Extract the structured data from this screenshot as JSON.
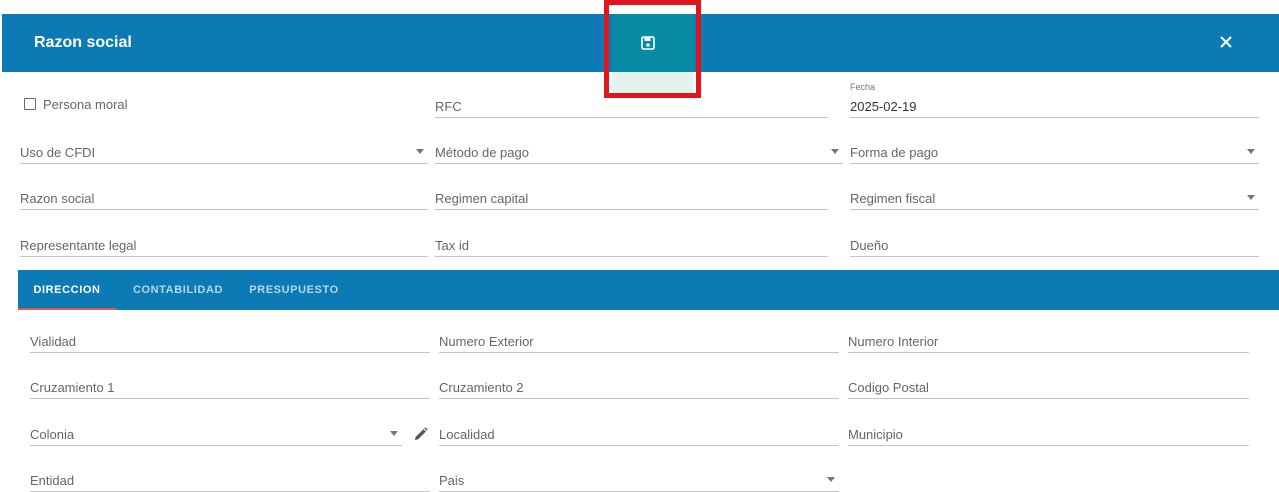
{
  "header": {
    "title": "Razon social",
    "save_icon": "floppy-disk-icon",
    "close_icon": "close-icon",
    "color": "#0c7ab5"
  },
  "form": {
    "persona_moral_label": "Persona moral",
    "rfc_placeholder": "RFC",
    "fecha_label": "Fecha",
    "fecha_value": "2025-02-19",
    "uso_cfdi_placeholder": "Uso de CFDI",
    "metodo_pago_placeholder": "Método de pago",
    "forma_pago_placeholder": "Forma de pago",
    "razon_social_placeholder": "Razon social",
    "regimen_capital_placeholder": "Regimen capital",
    "regimen_fiscal_placeholder": "Regimen fiscal",
    "representante_legal_placeholder": "Representante legal",
    "tax_id_placeholder": "Tax id",
    "dueno_placeholder": "Dueño"
  },
  "tabs": [
    {
      "label": "DIRECCION",
      "active": true
    },
    {
      "label": "CONTABILIDAD",
      "active": false
    },
    {
      "label": "PRESUPUESTO",
      "active": false
    }
  ],
  "direccion": {
    "vialidad_placeholder": "Vialidad",
    "numero_exterior_placeholder": "Numero Exterior",
    "numero_interior_placeholder": "Numero Interior",
    "cruzamiento1_placeholder": "Cruzamiento 1",
    "cruzamiento2_placeholder": "Cruzamiento 2",
    "codigo_postal_placeholder": "Codigo Postal",
    "colonia_placeholder": "Colonia",
    "localidad_placeholder": "Localidad",
    "municipio_placeholder": "Municipio",
    "entidad_placeholder": "Entidad",
    "pais_placeholder": "Pais",
    "edit_icon": "pencil-icon"
  },
  "highlight_color": "#e0161f"
}
